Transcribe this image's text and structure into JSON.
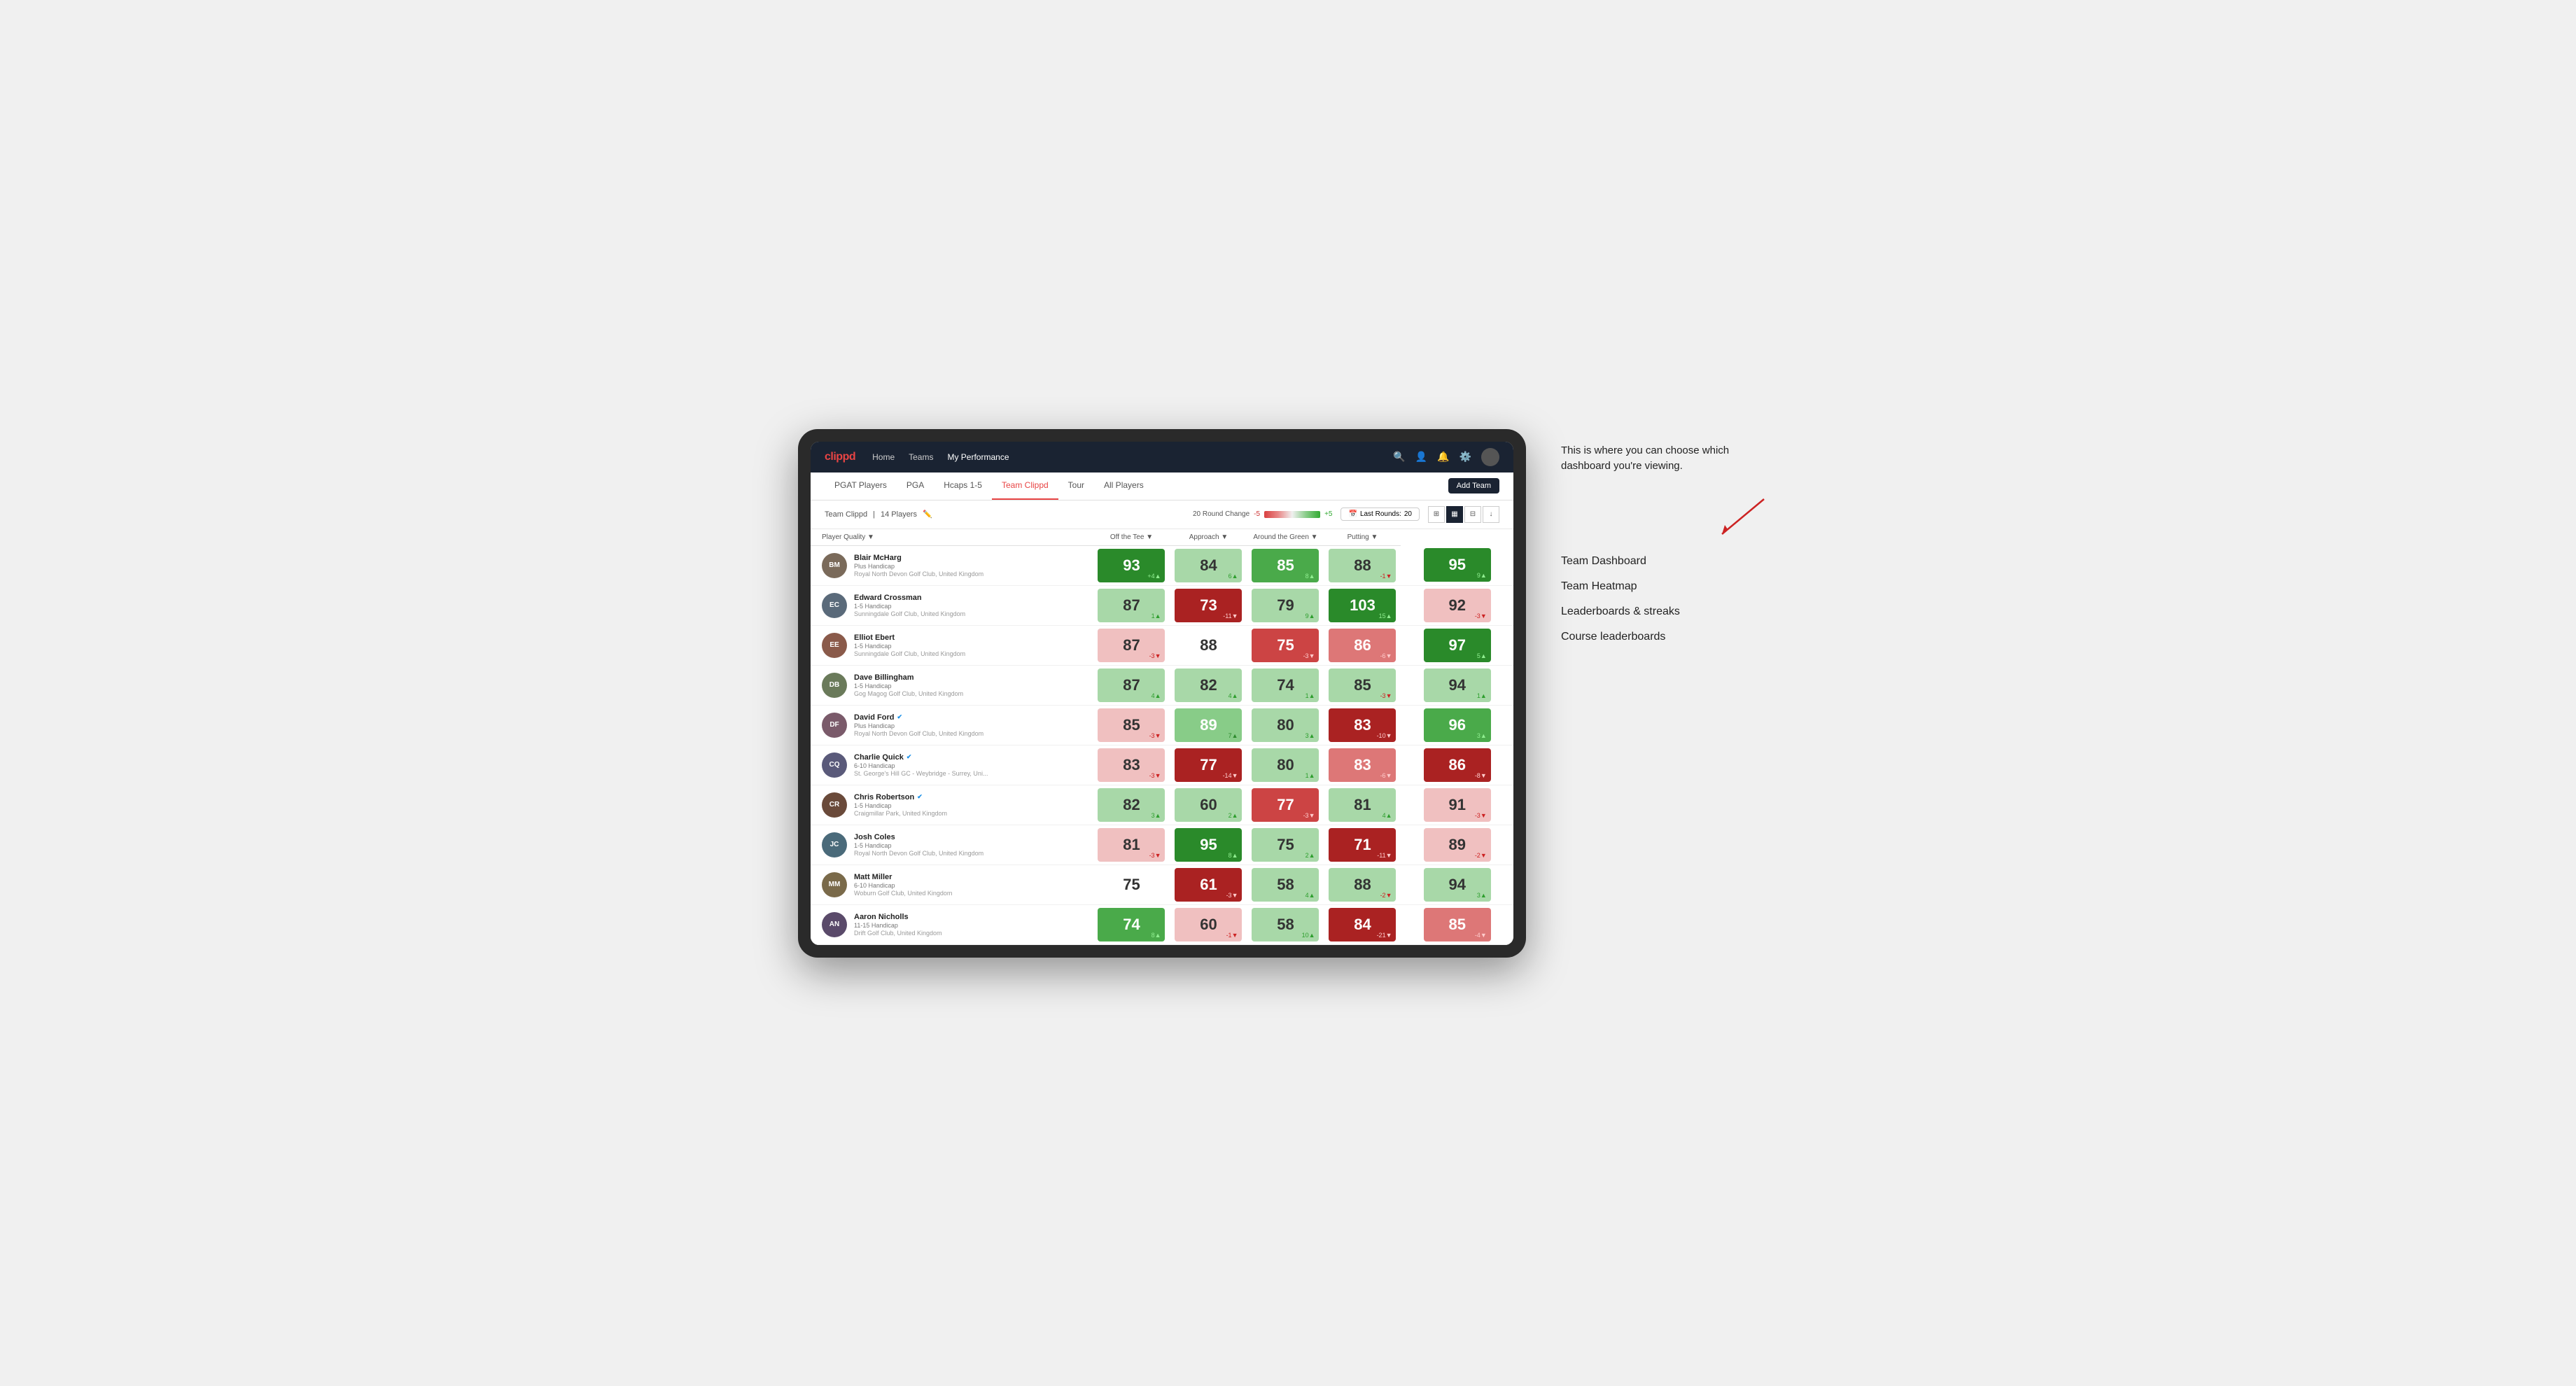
{
  "annotation": {
    "description": "This is where you can choose which dashboard you're viewing.",
    "items": [
      "Team Dashboard",
      "Team Heatmap",
      "Leaderboards & streaks",
      "Course leaderboards"
    ]
  },
  "nav": {
    "logo": "clippd",
    "links": [
      "Home",
      "Teams",
      "My Performance"
    ],
    "active_link": "My Performance"
  },
  "sub_nav": {
    "links": [
      "PGAT Players",
      "PGA",
      "Hcaps 1-5",
      "Team Clippd",
      "Tour",
      "All Players"
    ],
    "active_link": "Team Clippd",
    "add_team_label": "Add Team"
  },
  "team_bar": {
    "team_name": "Team Clippd",
    "player_count": "14 Players",
    "round_change_label": "20 Round Change",
    "round_change_neg": "-5",
    "round_change_pos": "+5",
    "last_rounds_label": "Last Rounds:",
    "last_rounds_value": "20"
  },
  "table": {
    "columns": [
      "Player Quality ▼",
      "Off the Tee ▼",
      "Approach ▼",
      "Around the Green ▼",
      "Putting ▼"
    ],
    "players": [
      {
        "name": "Blair McHarg",
        "handicap": "Plus Handicap",
        "club": "Royal North Devon Golf Club, United Kingdom",
        "avatar_color": "#7a6a5a",
        "initials": "BM",
        "verified": false,
        "scores": [
          {
            "value": 93,
            "change": "+4",
            "dir": "up",
            "bg": "bg-dark-green"
          },
          {
            "value": 84,
            "change": "6",
            "dir": "up",
            "bg": "bg-pale-green"
          },
          {
            "value": 85,
            "change": "8",
            "dir": "up",
            "bg": "bg-med-green"
          },
          {
            "value": 88,
            "change": "-1",
            "dir": "down",
            "bg": "bg-pale-green"
          },
          {
            "value": 95,
            "change": "9",
            "dir": "up",
            "bg": "bg-dark-green"
          }
        ]
      },
      {
        "name": "Edward Crossman",
        "handicap": "1-5 Handicap",
        "club": "Sunningdale Golf Club, United Kingdom",
        "avatar_color": "#5a6a7a",
        "initials": "EC",
        "verified": false,
        "scores": [
          {
            "value": 87,
            "change": "1",
            "dir": "up",
            "bg": "bg-pale-green"
          },
          {
            "value": 73,
            "change": "-11",
            "dir": "down",
            "bg": "bg-dark-red"
          },
          {
            "value": 79,
            "change": "9",
            "dir": "up",
            "bg": "bg-pale-green"
          },
          {
            "value": 103,
            "change": "15",
            "dir": "up",
            "bg": "bg-dark-green"
          },
          {
            "value": 92,
            "change": "-3",
            "dir": "down",
            "bg": "bg-pale-red"
          }
        ]
      },
      {
        "name": "Elliot Ebert",
        "handicap": "1-5 Handicap",
        "club": "Sunningdale Golf Club, United Kingdom",
        "avatar_color": "#8a5a4a",
        "initials": "EE",
        "verified": false,
        "scores": [
          {
            "value": 87,
            "change": "-3",
            "dir": "down",
            "bg": "bg-pale-red"
          },
          {
            "value": 88,
            "change": "",
            "dir": "none",
            "bg": "bg-white"
          },
          {
            "value": 75,
            "change": "-3",
            "dir": "down",
            "bg": "bg-med-red"
          },
          {
            "value": 86,
            "change": "-6",
            "dir": "down",
            "bg": "bg-light-red"
          },
          {
            "value": 97,
            "change": "5",
            "dir": "up",
            "bg": "bg-dark-green"
          }
        ]
      },
      {
        "name": "Dave Billingham",
        "handicap": "1-5 Handicap",
        "club": "Gog Magog Golf Club, United Kingdom",
        "avatar_color": "#6a7a5a",
        "initials": "DB",
        "verified": false,
        "scores": [
          {
            "value": 87,
            "change": "4",
            "dir": "up",
            "bg": "bg-pale-green"
          },
          {
            "value": 82,
            "change": "4",
            "dir": "up",
            "bg": "bg-pale-green"
          },
          {
            "value": 74,
            "change": "1",
            "dir": "up",
            "bg": "bg-pale-green"
          },
          {
            "value": 85,
            "change": "-3",
            "dir": "down",
            "bg": "bg-pale-green"
          },
          {
            "value": 94,
            "change": "1",
            "dir": "up",
            "bg": "bg-pale-green"
          }
        ]
      },
      {
        "name": "David Ford",
        "handicap": "Plus Handicap",
        "club": "Royal North Devon Golf Club, United Kingdom",
        "avatar_color": "#7a5a6a",
        "initials": "DF",
        "verified": true,
        "scores": [
          {
            "value": 85,
            "change": "-3",
            "dir": "down",
            "bg": "bg-pale-red"
          },
          {
            "value": 89,
            "change": "7",
            "dir": "up",
            "bg": "bg-light-green"
          },
          {
            "value": 80,
            "change": "3",
            "dir": "up",
            "bg": "bg-pale-green"
          },
          {
            "value": 83,
            "change": "-10",
            "dir": "down",
            "bg": "bg-dark-red"
          },
          {
            "value": 96,
            "change": "3",
            "dir": "up",
            "bg": "bg-med-green"
          }
        ]
      },
      {
        "name": "Charlie Quick",
        "handicap": "6-10 Handicap",
        "club": "St. George's Hill GC - Weybridge - Surrey, Uni...",
        "avatar_color": "#5a5a7a",
        "initials": "CQ",
        "verified": true,
        "scores": [
          {
            "value": 83,
            "change": "-3",
            "dir": "down",
            "bg": "bg-pale-red"
          },
          {
            "value": 77,
            "change": "-14",
            "dir": "down",
            "bg": "bg-dark-red"
          },
          {
            "value": 80,
            "change": "1",
            "dir": "up",
            "bg": "bg-pale-green"
          },
          {
            "value": 83,
            "change": "-6",
            "dir": "down",
            "bg": "bg-light-red"
          },
          {
            "value": 86,
            "change": "-8",
            "dir": "down",
            "bg": "bg-dark-red"
          }
        ]
      },
      {
        "name": "Chris Robertson",
        "handicap": "1-5 Handicap",
        "club": "Craigmillar Park, United Kingdom",
        "avatar_color": "#6a4a3a",
        "initials": "CR",
        "verified": true,
        "scores": [
          {
            "value": 82,
            "change": "3",
            "dir": "up",
            "bg": "bg-pale-green"
          },
          {
            "value": 60,
            "change": "2",
            "dir": "up",
            "bg": "bg-pale-green"
          },
          {
            "value": 77,
            "change": "-3",
            "dir": "down",
            "bg": "bg-med-red"
          },
          {
            "value": 81,
            "change": "4",
            "dir": "up",
            "bg": "bg-pale-green"
          },
          {
            "value": 91,
            "change": "-3",
            "dir": "down",
            "bg": "bg-pale-red"
          }
        ]
      },
      {
        "name": "Josh Coles",
        "handicap": "1-5 Handicap",
        "club": "Royal North Devon Golf Club, United Kingdom",
        "avatar_color": "#4a6a7a",
        "initials": "JC",
        "verified": false,
        "scores": [
          {
            "value": 81,
            "change": "-3",
            "dir": "down",
            "bg": "bg-pale-red"
          },
          {
            "value": 95,
            "change": "8",
            "dir": "up",
            "bg": "bg-dark-green"
          },
          {
            "value": 75,
            "change": "2",
            "dir": "up",
            "bg": "bg-pale-green"
          },
          {
            "value": 71,
            "change": "-11",
            "dir": "down",
            "bg": "bg-dark-red"
          },
          {
            "value": 89,
            "change": "-2",
            "dir": "down",
            "bg": "bg-pale-red"
          }
        ]
      },
      {
        "name": "Matt Miller",
        "handicap": "6-10 Handicap",
        "club": "Woburn Golf Club, United Kingdom",
        "avatar_color": "#7a6a4a",
        "initials": "MM",
        "verified": false,
        "scores": [
          {
            "value": 75,
            "change": "",
            "dir": "none",
            "bg": "bg-white"
          },
          {
            "value": 61,
            "change": "-3",
            "dir": "down",
            "bg": "bg-dark-red"
          },
          {
            "value": 58,
            "change": "4",
            "dir": "up",
            "bg": "bg-pale-green"
          },
          {
            "value": 88,
            "change": "-2",
            "dir": "down",
            "bg": "bg-pale-green"
          },
          {
            "value": 94,
            "change": "3",
            "dir": "up",
            "bg": "bg-pale-green"
          }
        ]
      },
      {
        "name": "Aaron Nicholls",
        "handicap": "11-15 Handicap",
        "club": "Drift Golf Club, United Kingdom",
        "avatar_color": "#5a4a6a",
        "initials": "AN",
        "verified": false,
        "scores": [
          {
            "value": 74,
            "change": "8",
            "dir": "up",
            "bg": "bg-med-green"
          },
          {
            "value": 60,
            "change": "-1",
            "dir": "down",
            "bg": "bg-pale-red"
          },
          {
            "value": 58,
            "change": "10",
            "dir": "up",
            "bg": "bg-pale-green"
          },
          {
            "value": 84,
            "change": "-21",
            "dir": "down",
            "bg": "bg-dark-red"
          },
          {
            "value": 85,
            "change": "-4",
            "dir": "down",
            "bg": "bg-light-red"
          }
        ]
      }
    ]
  }
}
